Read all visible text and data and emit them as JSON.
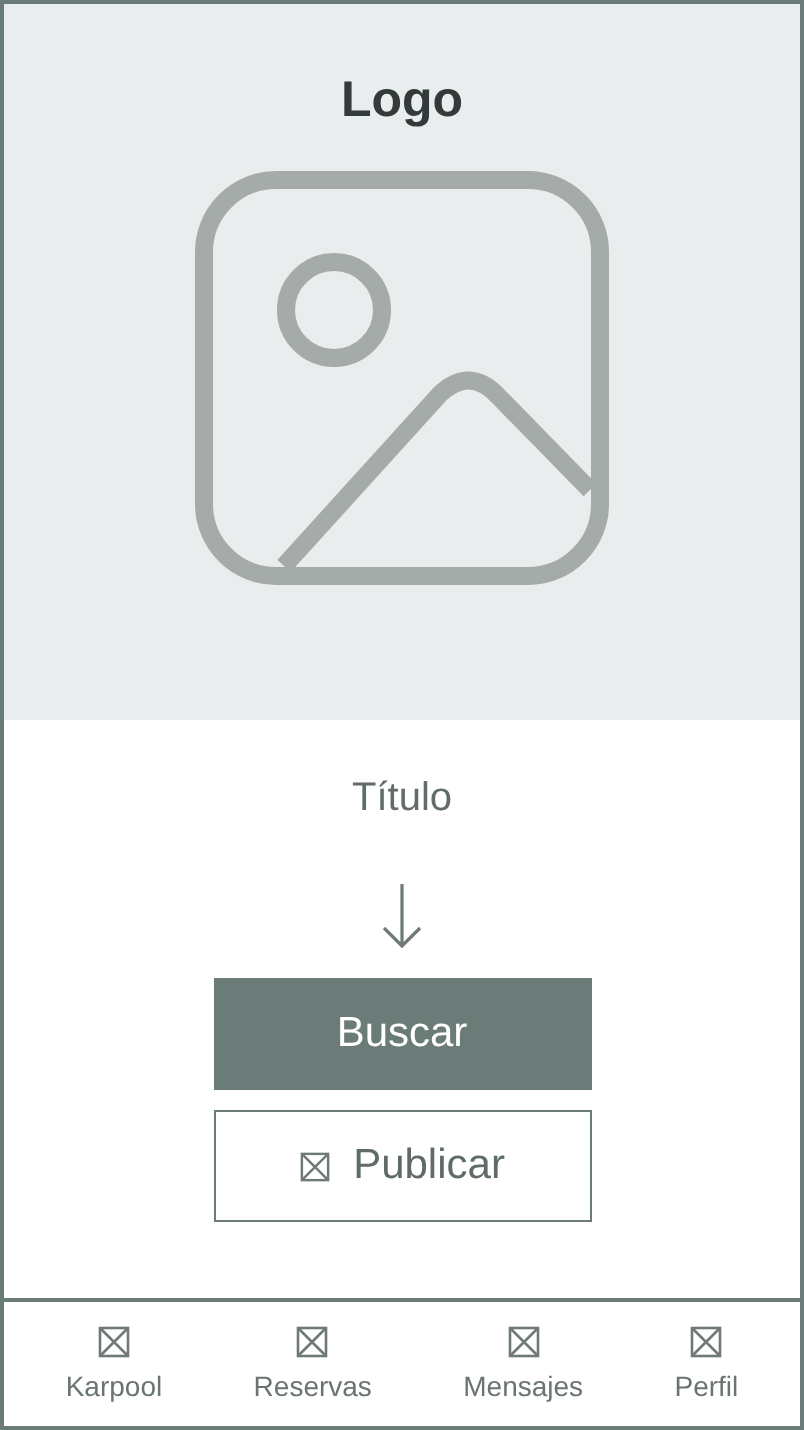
{
  "header": {
    "logo": "Logo"
  },
  "title": "Título",
  "buttons": [
    {
      "label": "Buscar",
      "kind": "primary"
    },
    {
      "label": "Publicar",
      "kind": "secondary"
    }
  ],
  "nav": [
    {
      "label": "Karpool"
    },
    {
      "label": "Reservas"
    },
    {
      "label": "Mensajes"
    },
    {
      "label": "Perfil"
    }
  ]
}
